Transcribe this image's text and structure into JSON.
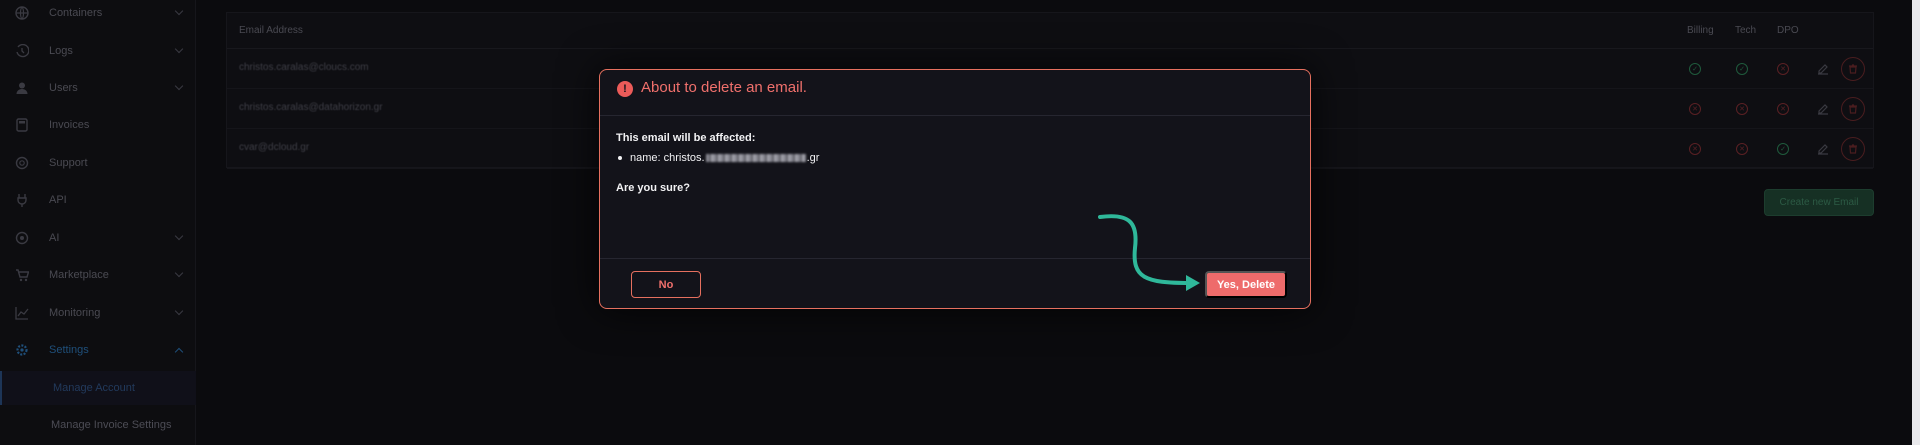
{
  "sidebar": {
    "items": [
      {
        "label": "Containers",
        "icon": "globe-icon",
        "chevron": true
      },
      {
        "label": "Logs",
        "icon": "history-icon",
        "chevron": true
      },
      {
        "label": "Users",
        "icon": "user-icon",
        "chevron": true
      },
      {
        "label": "Invoices",
        "icon": "calculator-icon",
        "chevron": false
      },
      {
        "label": "Support",
        "icon": "lifebuoy-icon",
        "chevron": false
      },
      {
        "label": "API",
        "icon": "plug-icon",
        "chevron": false
      },
      {
        "label": "AI",
        "icon": "ai-icon",
        "chevron": true
      },
      {
        "label": "Marketplace",
        "icon": "cart-icon",
        "chevron": true
      },
      {
        "label": "Monitoring",
        "icon": "chart-icon",
        "chevron": true
      },
      {
        "label": "Settings",
        "icon": "gear-icon",
        "chevron": true,
        "active": true
      }
    ],
    "subitems": [
      {
        "label": "Manage Account",
        "selected": true
      },
      {
        "label": "Manage Invoice Settings",
        "selected": false
      }
    ]
  },
  "table": {
    "headers": {
      "email": "Email Address",
      "billing": "Billing",
      "tech": "Tech",
      "dpo": "DPO"
    },
    "rows": [
      {
        "email": "christos.caralas@cloucs.com",
        "billing": true,
        "tech": true,
        "dpo": false
      },
      {
        "email": "christos.caralas@datahorizon.gr",
        "billing": false,
        "tech": false,
        "dpo": false
      },
      {
        "email": "cvar@dcloud.gr",
        "billing": false,
        "tech": false,
        "dpo": true
      }
    ]
  },
  "create_button": "Create new Email",
  "modal": {
    "title": "About to delete an email.",
    "affected_label": "This email will be affected:",
    "name_prefix": "name: christos.",
    "name_suffix": ".gr",
    "confirm_question": "Are you sure?",
    "no_label": "No",
    "yes_label": "Yes, Delete"
  },
  "colors": {
    "accent": "#ee6b6b",
    "modal_border": "#e6705f",
    "arrow": "#2fb89a"
  }
}
